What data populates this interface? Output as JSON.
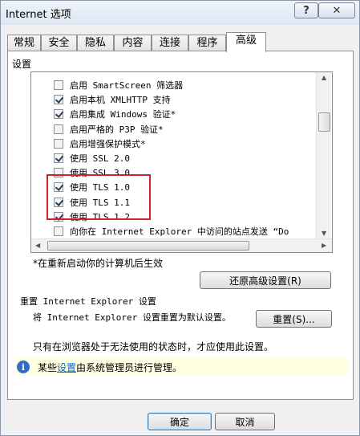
{
  "window": {
    "title": "Internet 选项",
    "help_label": "?",
    "close_label": "✕"
  },
  "tabs": [
    {
      "label": "常规"
    },
    {
      "label": "安全"
    },
    {
      "label": "隐私"
    },
    {
      "label": "内容"
    },
    {
      "label": "连接"
    },
    {
      "label": "程序"
    },
    {
      "label": "高级"
    }
  ],
  "settings_section_label": "设置",
  "settings_items": [
    {
      "label": "启用 SmartScreen 筛选器",
      "checked": false
    },
    {
      "label": "启用本机 XMLHTTP 支持",
      "checked": true
    },
    {
      "label": "启用集成 Windows 验证*",
      "checked": true
    },
    {
      "label": "启用严格的 P3P 验证*",
      "checked": false
    },
    {
      "label": "启用增强保护模式*",
      "checked": false
    },
    {
      "label": "使用 SSL 2.0",
      "checked": true
    },
    {
      "label": "使用 SSL 3.0",
      "checked": false
    },
    {
      "label": "使用 TLS 1.0",
      "checked": true
    },
    {
      "label": "使用 TLS 1.1",
      "checked": true
    },
    {
      "label": "使用 TLS 1.2",
      "checked": true
    },
    {
      "label": "向你在 Internet Explorer 中访问的站点发送 “Do",
      "checked": false
    }
  ],
  "restart_note": "*在重新启动你的计算机后生效",
  "restore_button_label": "还原高级设置(R)",
  "reset_section_label": "重置 Internet Explorer 设置",
  "reset_description": "将 Internet Explorer 设置重置为默认设置。",
  "reset_button_label": "重置(S)...",
  "reset_hint": "只有在浏览器处于无法使用的状态时，才应使用此设置。",
  "managed_info": {
    "prefix": "某些",
    "link": "设置",
    "suffix": "由系统管理员进行管理。"
  },
  "ok_button_label": "确定",
  "cancel_button_label": "取消"
}
